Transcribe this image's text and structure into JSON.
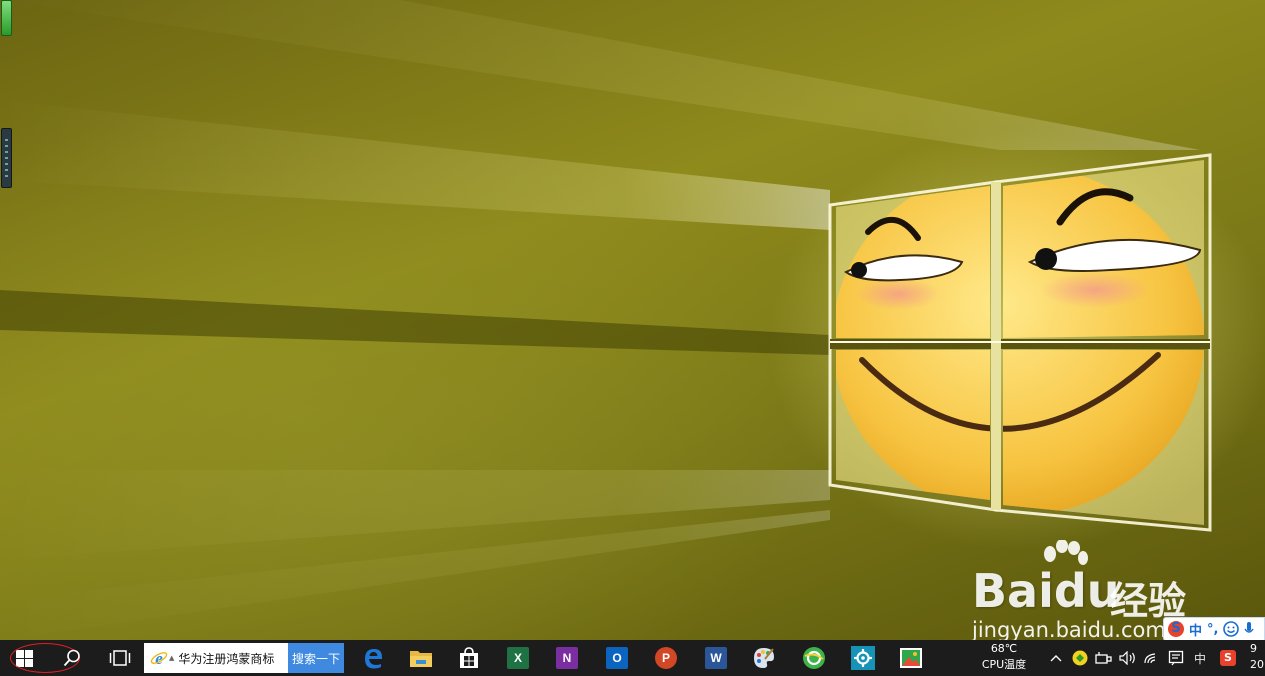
{
  "watermark": {
    "logo_prefix": "Bai",
    "logo_suffix": "du",
    "brand_cn": "经验",
    "url": "jingyan.baidu.com"
  },
  "ime_float": {
    "mode": "中",
    "punct": "°,"
  },
  "taskbar": {
    "search_query": "华为注册鸿蒙商标",
    "search_button": "搜索一下",
    "apps": [
      {
        "name": "edge",
        "glyph": "e",
        "color": "#1e78d7"
      },
      {
        "name": "file-explorer",
        "glyph": "",
        "color": "#e8b844"
      },
      {
        "name": "store",
        "glyph": "",
        "color": "#ffffff"
      },
      {
        "name": "excel",
        "glyph": "X",
        "color": "#1f7244"
      },
      {
        "name": "onenote",
        "glyph": "N",
        "color": "#7a2ea0"
      },
      {
        "name": "outlook",
        "glyph": "O",
        "color": "#0a64c0"
      },
      {
        "name": "powerpoint",
        "glyph": "P",
        "color": "#d24726"
      },
      {
        "name": "word",
        "glyph": "W",
        "color": "#2b579a"
      },
      {
        "name": "paint",
        "glyph": "",
        "color": "#5aa0d8"
      },
      {
        "name": "360-browser",
        "glyph": "",
        "color": "#3cb44a"
      },
      {
        "name": "settings-app",
        "glyph": "",
        "color": "#1793b8"
      },
      {
        "name": "photos-app",
        "glyph": "",
        "color": "#2ea84a"
      }
    ],
    "cpu_temp_value": "68℃",
    "cpu_temp_label": "CPU温度",
    "ime_indicator": "中",
    "clock_line1": "9",
    "clock_line2": "20"
  }
}
